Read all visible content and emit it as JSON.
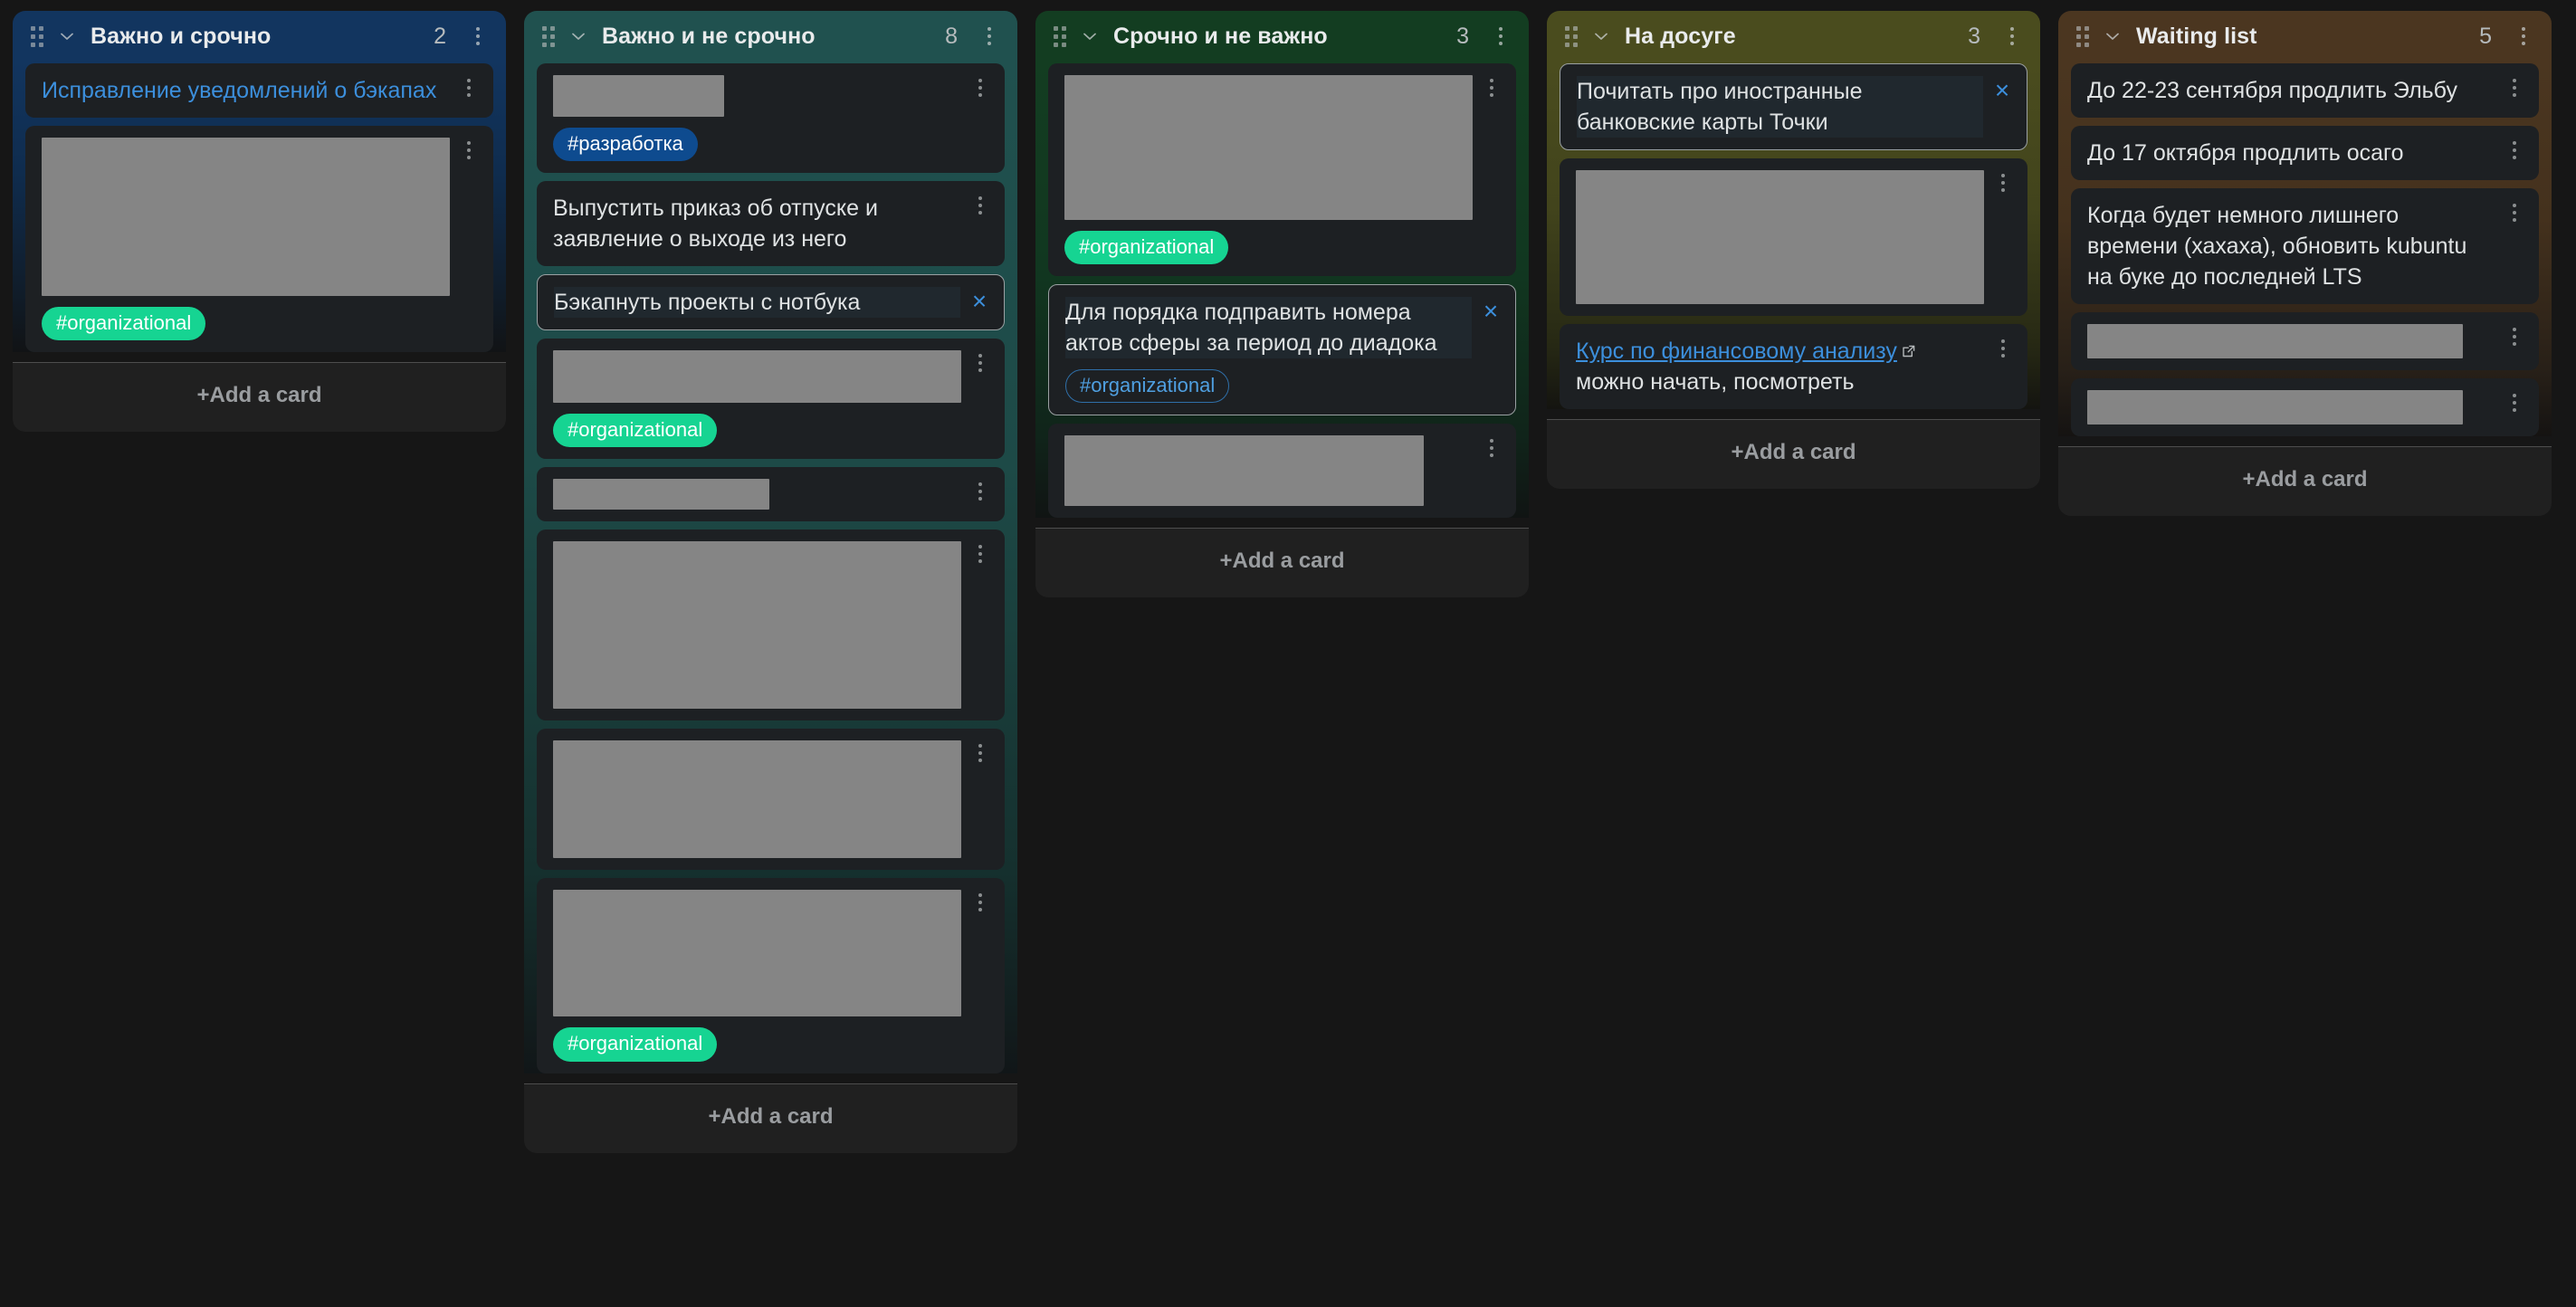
{
  "board": {
    "add_card_label": "+Add a card",
    "colors": {
      "tag_green": "#16d492",
      "tag_blue": "#0e4b8f",
      "link_blue": "#3c8fdc",
      "card_bg": "#1d2023",
      "page_bg": "#161616"
    }
  },
  "columns": [
    {
      "title": "Важно и срочно",
      "count": "2",
      "header_color": "#12355f",
      "cards": [
        {
          "text": "Исправление уведомлений о бэкапах",
          "style": "link"
        },
        {
          "redacted": true,
          "tag": "#organizational",
          "tag_style": "green"
        }
      ]
    },
    {
      "title": "Важно и не срочно",
      "count": "8",
      "header_color": "#20514f",
      "cards": [
        {
          "redacted": true,
          "tag": "#разработка",
          "tag_style": "blue"
        },
        {
          "text": "Выпустить приказ об отпуске и заявление о выходе из него"
        },
        {
          "text": "Бэкапнуть проекты с нотбука",
          "editing": true
        },
        {
          "redacted": true,
          "tag": "#organizational",
          "tag_style": "green"
        },
        {
          "redacted": true
        },
        {
          "redacted": true
        },
        {
          "redacted": true
        },
        {
          "redacted": true,
          "tag": "#organizational",
          "tag_style": "green"
        }
      ]
    },
    {
      "title": "Срочно и не важно",
      "count": "3",
      "header_color": "#133d21",
      "cards": [
        {
          "redacted": true,
          "tag": "#organizational",
          "tag_style": "green"
        },
        {
          "text": "Для порядка подправить номера актов сферы за период до диадока",
          "editing": true,
          "tag": "#organizational",
          "tag_style": "outline"
        },
        {
          "redacted": true
        }
      ]
    },
    {
      "title": "На досуге",
      "count": "3",
      "header_color": "#4a4c1e",
      "cards": [
        {
          "text": "Почитать про иностранные банковские карты Точки",
          "editing": true
        },
        {
          "redacted": true
        },
        {
          "link_text": "Курс по финансовому анализу",
          "rest_text": "можно начать, посмотреть",
          "has_external_icon": true
        }
      ]
    },
    {
      "title": "Waiting list",
      "count": "5",
      "header_color": "#4b3620",
      "cards": [
        {
          "text": "До 22-23 сентября продлить Эльбу"
        },
        {
          "text": "До 17 октября продлить осаго"
        },
        {
          "text": "Когда будет немного лишнего времени (хахаха), обновить kubuntu на буке до последней LTS"
        },
        {
          "redacted": true
        },
        {
          "redacted": true
        }
      ]
    }
  ]
}
